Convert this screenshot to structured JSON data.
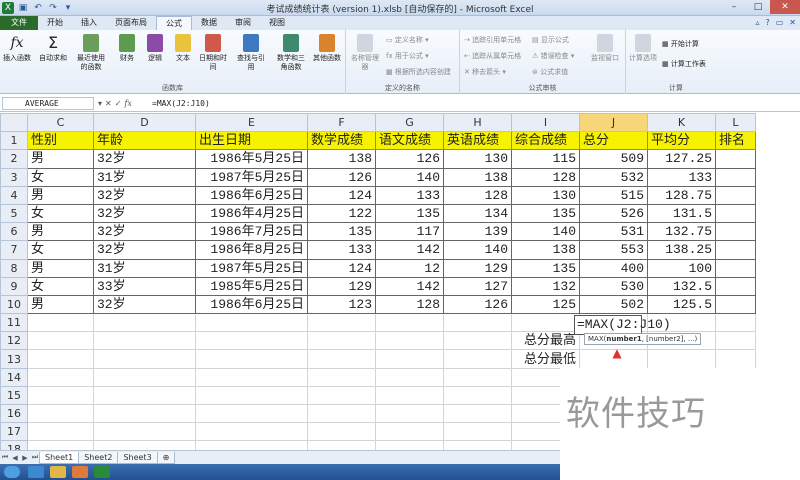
{
  "window": {
    "title": "考试成绩统计表 (version 1).xlsb [自动保存的] - Microsoft Excel"
  },
  "ribbon": {
    "tabs": [
      "文件",
      "开始",
      "插入",
      "页面布局",
      "公式",
      "数据",
      "审阅",
      "视图"
    ],
    "active_tab": "公式",
    "groups": {
      "function_library": {
        "label": "函数库",
        "insert_function": "插入函数",
        "autosum": "自动求和",
        "recently_used": "最近使用的函数",
        "financial": "财务",
        "logical": "逻辑",
        "text": "文本",
        "date_time": "日期和时间",
        "lookup": "查找与引用",
        "math_trig": "数学和三角函数",
        "more": "其他函数"
      },
      "defined_names": {
        "label": "定义的名称",
        "name_manager": "名称管理器",
        "define_name": "定义名称",
        "use_in_formula": "用于公式",
        "create_from_selection": "根据所选内容创建"
      },
      "formula_auditing": {
        "label": "公式审核",
        "trace_precedents": "追踪引用单元格",
        "trace_dependents": "追踪从属单元格",
        "remove_arrows": "移去箭头",
        "show_formulas": "显示公式",
        "error_checking": "错误检查",
        "evaluate": "公式求值",
        "watch_window": "监视窗口"
      },
      "calculation": {
        "label": "计算",
        "options": "计算选项",
        "calc_now": "开始计算",
        "calc_sheet": "计算工作表"
      }
    }
  },
  "formula_bar": {
    "name_box": "AVERAGE",
    "formula": "=MAX(J2:J10)"
  },
  "grid": {
    "columns": [
      "C",
      "D",
      "E",
      "F",
      "G",
      "H",
      "I",
      "J",
      "K",
      "L"
    ],
    "selected_column": "J",
    "row_numbers": [
      "1",
      "2",
      "3",
      "4",
      "5",
      "6",
      "7",
      "8",
      "9",
      "10",
      "11",
      "12",
      "13",
      "14",
      "15",
      "16",
      "17",
      "18"
    ],
    "headers": [
      "性别",
      "年龄",
      "出生日期",
      "数学成绩",
      "语文成绩",
      "英语成绩",
      "综合成绩",
      "总分",
      "平均分",
      "排名"
    ],
    "rows": [
      [
        "男",
        "32岁",
        "1986年5月25日",
        "138",
        "126",
        "130",
        "115",
        "509",
        "127.25",
        ""
      ],
      [
        "女",
        "31岁",
        "1987年5月25日",
        "126",
        "140",
        "138",
        "128",
        "532",
        "133",
        ""
      ],
      [
        "男",
        "32岁",
        "1986年6月25日",
        "124",
        "133",
        "128",
        "130",
        "515",
        "128.75",
        ""
      ],
      [
        "女",
        "32岁",
        "1986年4月25日",
        "122",
        "135",
        "134",
        "135",
        "526",
        "131.5",
        ""
      ],
      [
        "男",
        "32岁",
        "1986年7月25日",
        "135",
        "117",
        "139",
        "140",
        "531",
        "132.75",
        ""
      ],
      [
        "女",
        "32岁",
        "1986年8月25日",
        "133",
        "142",
        "140",
        "138",
        "553",
        "138.25",
        ""
      ],
      [
        "男",
        "31岁",
        "1987年5月25日",
        "124",
        "12",
        "129",
        "135",
        "400",
        "100",
        ""
      ],
      [
        "女",
        "33岁",
        "1985年5月25日",
        "129",
        "142",
        "127",
        "132",
        "530",
        "132.5",
        ""
      ],
      [
        "男",
        "32岁",
        "1986年6月25日",
        "123",
        "128",
        "126",
        "125",
        "502",
        "125.5",
        ""
      ]
    ],
    "summary": {
      "max_label": "总分最高",
      "min_label": "总分最低",
      "editing_formula": "=MAX(J2:J10)"
    },
    "tooltip": {
      "fn": "MAX(",
      "arg1": "number1",
      "rest": ", [number2], ...)"
    }
  },
  "sheets": [
    "Sheet1",
    "Sheet2",
    "Sheet3"
  ],
  "active_sheet": "Sheet1",
  "watermark": "软件技巧",
  "colors": {
    "header_fill": "#f7f200",
    "file_tab": "#2a6a2a",
    "accent": "#2b5797"
  }
}
